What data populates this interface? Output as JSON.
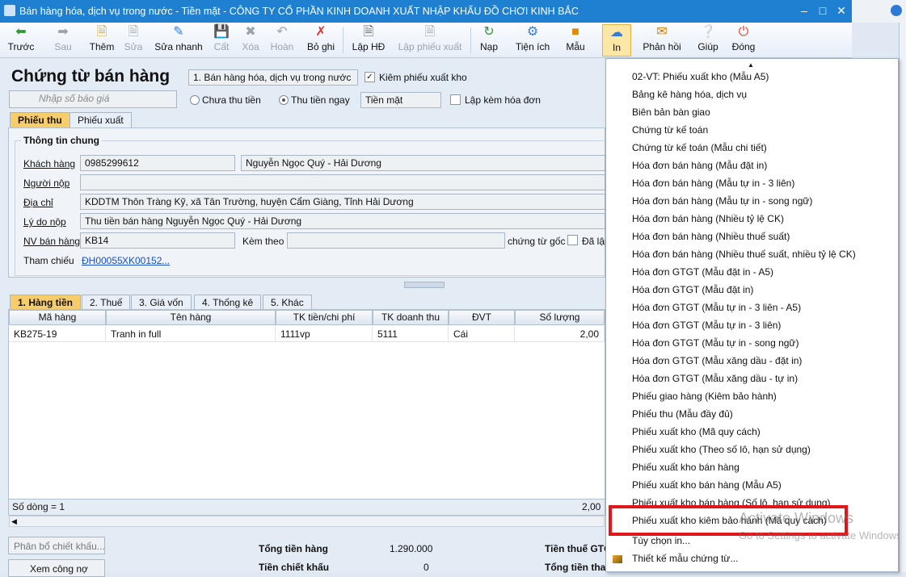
{
  "window": {
    "title": "Bán hàng hóa, dịch vụ trong nước - Tiền mặt - CÔNG TY CỔ PHẦN KINH DOANH XUẤT NHẬP KHẨU ĐỒ CHƠI KINH BẮC"
  },
  "toolbar": {
    "prev": "Trước",
    "next": "Sau",
    "add": "Thêm",
    "edit": "Sửa",
    "quick_edit": "Sửa nhanh",
    "save": "Cất",
    "delete": "Xóa",
    "undo": "Hoàn",
    "unpost": "Bỏ ghi",
    "create_invoice": "Lập HĐ",
    "create_delivery": "Lập phiếu xuất",
    "load": "Nạp",
    "utilities": "Tiện ích",
    "template": "Mẫu",
    "print": "In",
    "feedback": "Phản hồi",
    "help": "Giúp",
    "close": "Đóng"
  },
  "form": {
    "heading": "Chứng từ bán hàng",
    "type_value": "1. Bán hàng hóa, dịch vụ trong nước",
    "check_delivery": "Kiêm phiếu xuất kho",
    "price_list_placeholder": "Nhập số báo giá",
    "radio_unpaid": "Chưa thu tiền",
    "radio_paid": "Thu tiền ngay",
    "payment_method": "Tiền mặt",
    "check_invoice": "Lập kèm hóa đơn"
  },
  "tabs_top": [
    "Phiếu thu",
    "Phiếu xuất"
  ],
  "general": {
    "section": "Thông tin chung",
    "customer_label": "Khách hàng",
    "customer_code": "0985299612",
    "customer_name": "Nguyễn Ngọc Quý - Hải Dương",
    "payer_label": "Người nộp",
    "address_label": "Địa chỉ",
    "address": "KDDTM Thôn Tràng Kỹ, xã Tân Trường, huyện Cẩm Giàng, Tỉnh Hải Dương",
    "reason_label": "Lý do nộp",
    "reason": "Thu tiền bán hàng Nguyễn Ngọc Quý - Hải Dương",
    "staff_label": "NV bán hàng",
    "staff": "KB14",
    "attach_label": "Kèm theo",
    "attach_suffix": "chứng từ gốc",
    "issued_label": "Đã lập",
    "ref_label": "Tham chiếu",
    "ref1": "ĐH00055",
    "ref2": "XK00152",
    "ref_more": "..."
  },
  "tabs_detail": [
    "1. Hàng tiền",
    "2. Thuế",
    "3. Giá vốn",
    "4. Thống kê",
    "5. Khác"
  ],
  "grid": {
    "columns": [
      "Mã hàng",
      "Tên hàng",
      "TK tiền/chi phí",
      "TK doanh thu",
      "ĐVT",
      "Số lượng"
    ],
    "rows": [
      [
        "KB275-19",
        "Tranh in full",
        "1111vp",
        "5111",
        "Cái",
        "2,00"
      ]
    ],
    "row_count": "Số dòng = 1",
    "total_qty": "2,00"
  },
  "footer": {
    "allocate_discount": "Phân bổ chiết khấu...",
    "view_debt": "Xem công nợ",
    "total_goods_label": "Tổng tiền hàng",
    "total_goods": "1.290.000",
    "discount_label": "Tiền chiết khấu",
    "discount": "0",
    "vat_label": "Tiền thuế GTG",
    "pay_label": "Tổng tiền tha"
  },
  "print_menu": {
    "items": [
      "02-VT: Phiếu xuất kho (Mẫu A5)",
      "Bảng kê hàng hóa, dịch vụ",
      "Biên bản bàn giao",
      "Chứng từ kế toán",
      "Chứng từ kế toán (Mẫu chi tiết)",
      "Hóa đơn bán hàng (Mẫu đặt in)",
      "Hóa đơn bán hàng (Mẫu tự in - 3 liên)",
      "Hóa đơn bán hàng (Mẫu tự in - song ngữ)",
      "Hóa đơn bán hàng (Nhiều tỷ lệ CK)",
      "Hóa đơn bán hàng (Nhiều thuế suất)",
      "Hóa đơn bán hàng (Nhiều thuế suất, nhiều tỷ lệ CK)",
      "Hóa đơn GTGT (Mẫu đặt in - A5)",
      "Hóa đơn GTGT (Mẫu đặt in)",
      "Hóa đơn GTGT (Mẫu tự in - 3 liên - A5)",
      "Hóa đơn GTGT (Mẫu tự in - 3 liên)",
      "Hóa đơn GTGT (Mẫu tự in - song ngữ)",
      "Hóa đơn GTGT (Mẫu xăng dầu - đặt in)",
      "Hóa đơn GTGT (Mẫu xăng dầu - tự in)",
      "Phiếu giao hàng (Kiêm bảo hành)",
      "Phiếu thu (Mẫu đầy đủ)",
      "Phiếu xuất kho (Mã quy cách)",
      "Phiếu xuất kho (Theo số lô, hạn sử dụng)",
      "Phiếu xuất kho bán hàng",
      "Phiếu xuất kho bán hàng (Mẫu A5)",
      "Phiếu xuất kho bán hàng (Số lô, hạn sử dụng)",
      "Phiếu xuất kho kiêm bảo hành (Mã quy cách)",
      "Tùy chọn in...",
      "Thiết kế mẫu chứng từ..."
    ]
  },
  "watermark": {
    "line1": "Activate Windows",
    "line2": "Go to Settings to activate Windows."
  },
  "colors": {
    "titlebar": "#1f7fd1",
    "active_tab": "#f7cd6b",
    "highlight_box": "#e0161b"
  }
}
